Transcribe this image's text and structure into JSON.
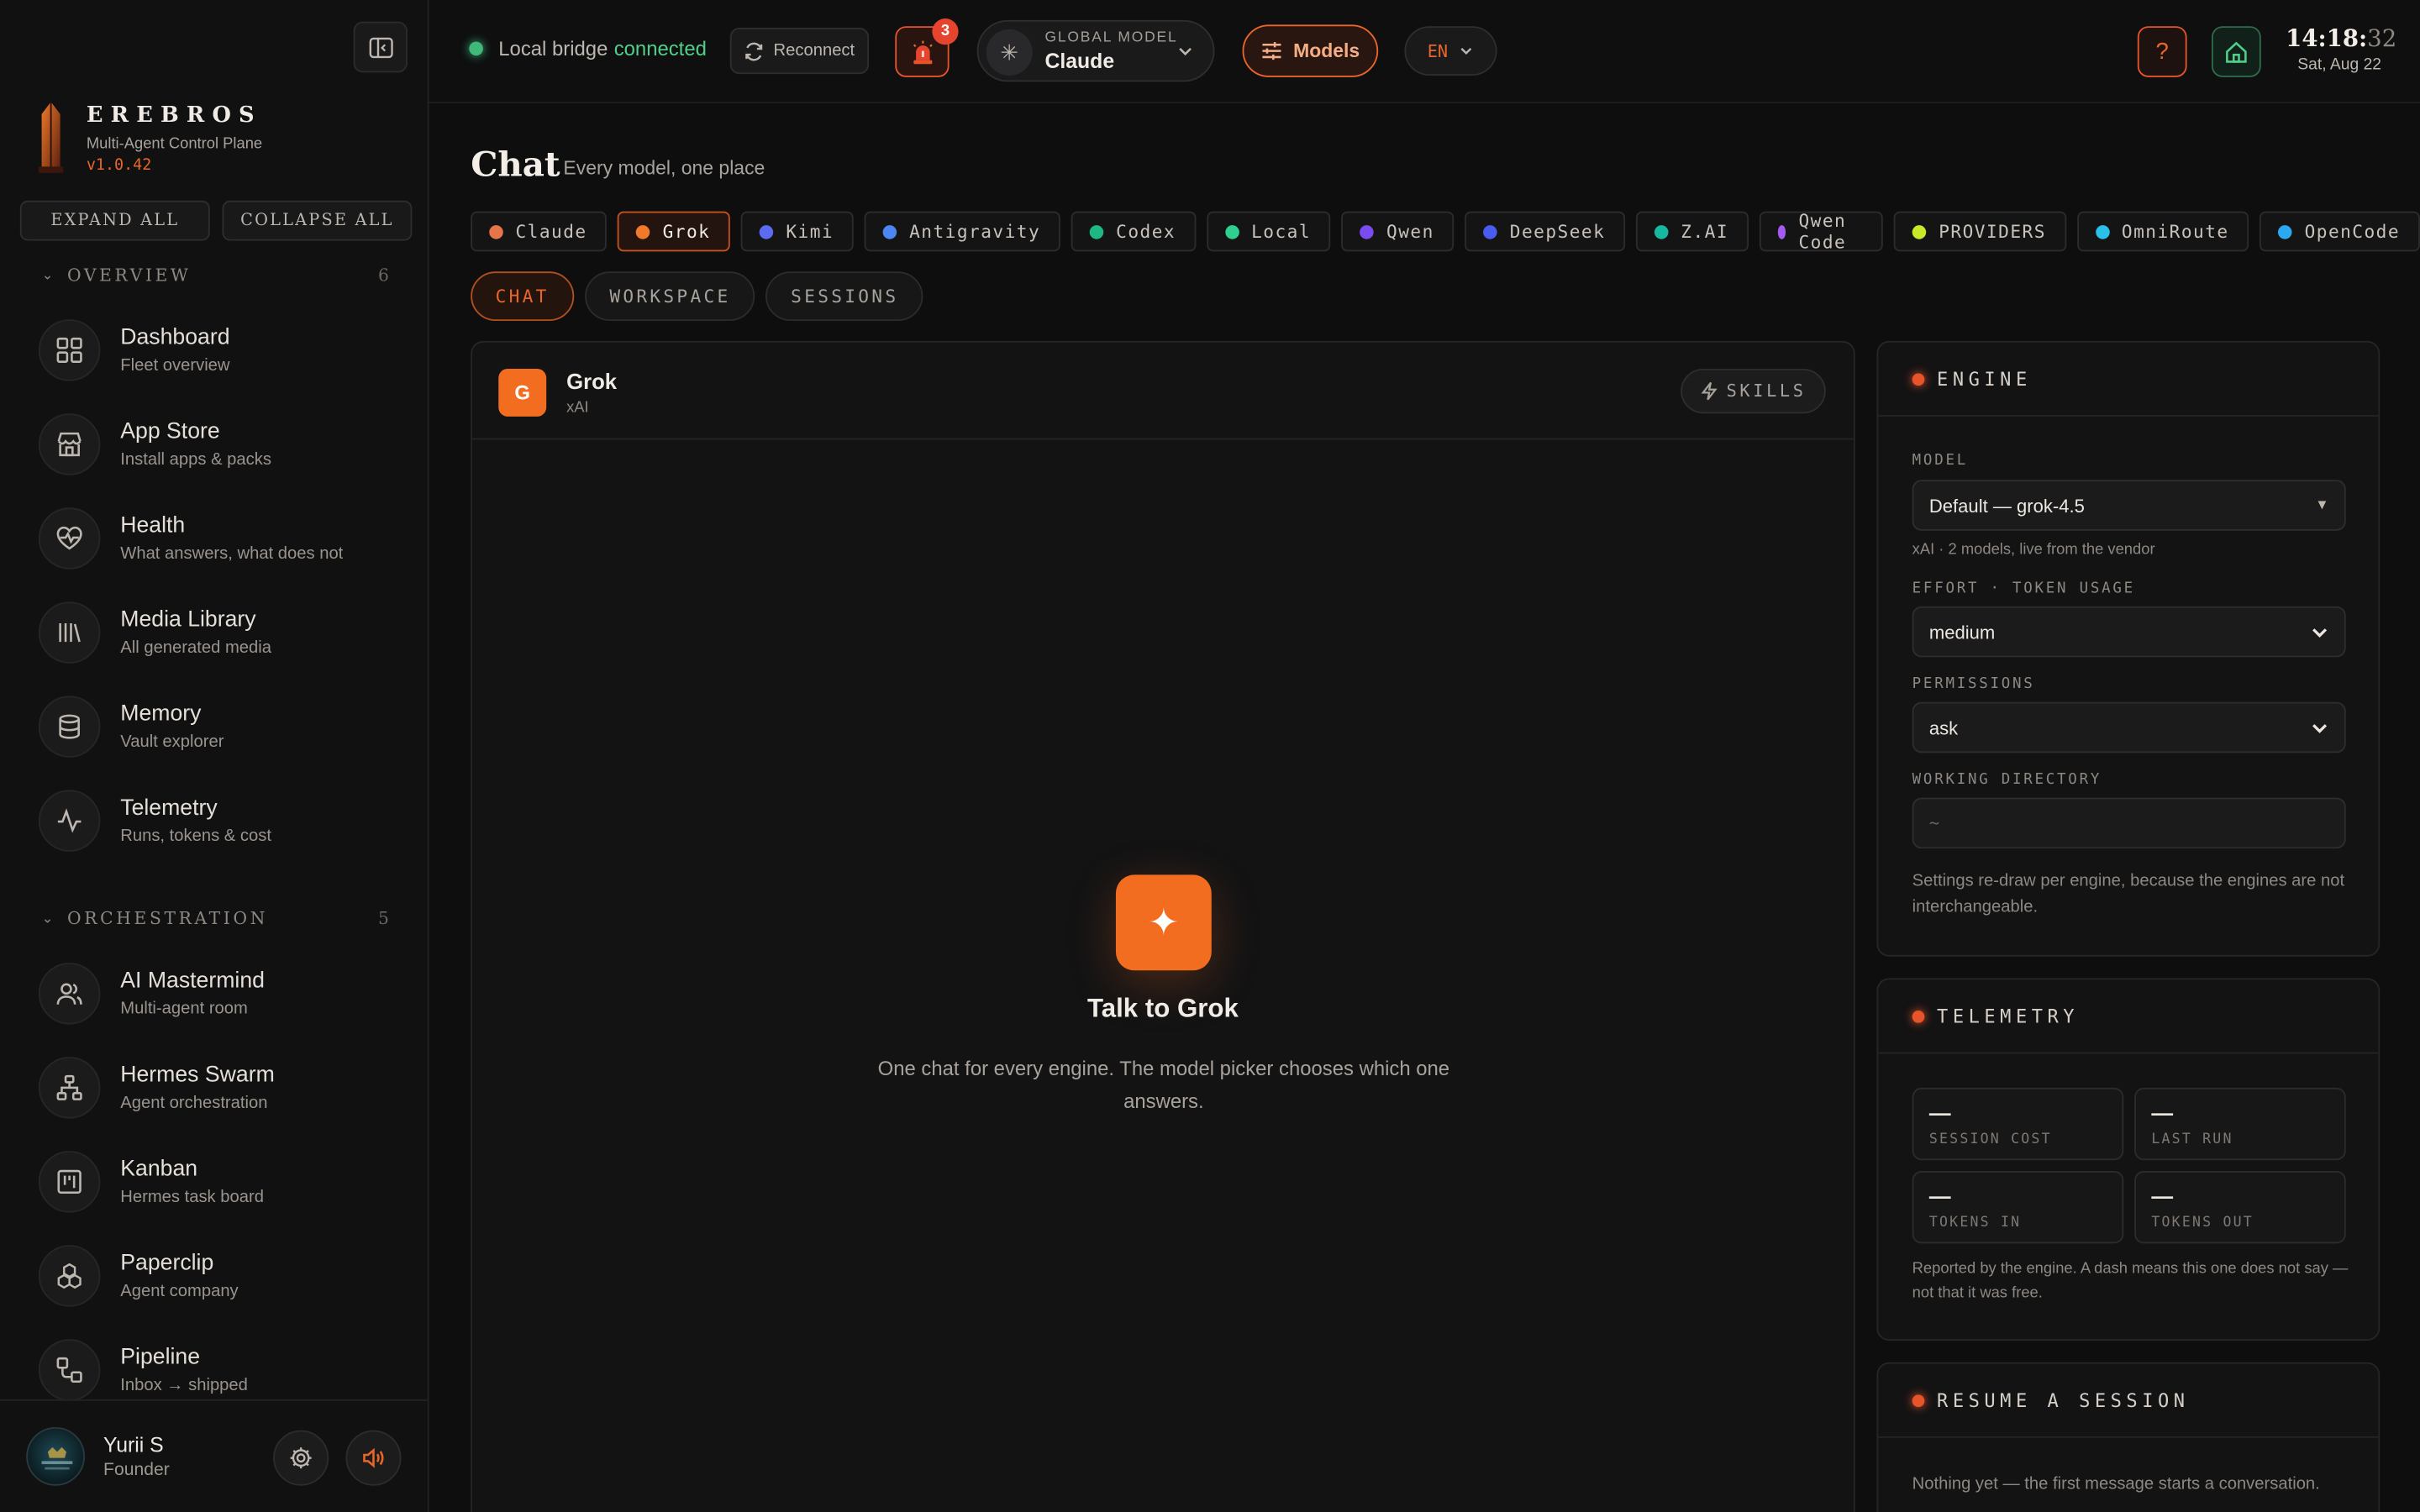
{
  "brand": {
    "title": "EREBROS",
    "subtitle": "Multi-Agent Control Plane",
    "version": "v1.0.42"
  },
  "sidebar": {
    "expand_all": "EXPAND ALL",
    "collapse_all": "COLLAPSE ALL",
    "overview": {
      "label": "OVERVIEW",
      "count": "6",
      "items": [
        {
          "title": "Dashboard",
          "sub": "Fleet overview",
          "icon": "grid-icon"
        },
        {
          "title": "App Store",
          "sub": "Install apps & packs",
          "icon": "store-icon"
        },
        {
          "title": "Health",
          "sub": "What answers, what does not",
          "icon": "heart-pulse-icon"
        },
        {
          "title": "Media Library",
          "sub": "All generated media",
          "icon": "library-icon"
        },
        {
          "title": "Memory",
          "sub": "Vault explorer",
          "icon": "database-icon"
        },
        {
          "title": "Telemetry",
          "sub": "Runs, tokens & cost",
          "icon": "activity-icon"
        }
      ]
    },
    "orchestration": {
      "label": "ORCHESTRATION",
      "count": "5",
      "items": [
        {
          "title": "AI Mastermind",
          "sub": "Multi-agent room",
          "icon": "users-icon"
        },
        {
          "title": "Hermes Swarm",
          "sub": "Agent orchestration",
          "icon": "network-icon"
        },
        {
          "title": "Kanban",
          "sub": "Hermes task board",
          "icon": "kanban-icon"
        },
        {
          "title": "Paperclip",
          "sub": "Agent company",
          "icon": "boxes-icon"
        },
        {
          "title": "Pipeline",
          "sub": "Inbox → shipped",
          "icon": "workflow-icon"
        }
      ]
    }
  },
  "user": {
    "name": "Yurii S",
    "role": "Founder"
  },
  "topbar": {
    "bridge_text": "Local bridge",
    "bridge_status": "connected",
    "reconnect": "Reconnect",
    "alarm_count": "3",
    "global_model_label": "GLOBAL MODEL",
    "global_model_value": "Claude",
    "models": "Models",
    "lang": "EN",
    "help": "?",
    "time_hm": "14:18:",
    "time_s": "32",
    "date": "Sat, Aug 22"
  },
  "page": {
    "title": "Chat",
    "subtitle": "Every model, one place"
  },
  "engines": [
    {
      "label": "Claude",
      "color": "#e8754a"
    },
    {
      "label": "Grok",
      "color": "#f07a2a",
      "active": true
    },
    {
      "label": "Kimi",
      "color": "#5b6cf0"
    },
    {
      "label": "Antigravity",
      "color": "#4c86f0"
    },
    {
      "label": "Codex",
      "color": "#1fb884"
    },
    {
      "label": "Local",
      "color": "#2fcf8f"
    },
    {
      "label": "Qwen",
      "color": "#7a4cf0"
    },
    {
      "label": "DeepSeek",
      "color": "#4a5cf0"
    },
    {
      "label": "Z.AI",
      "color": "#17b8a0"
    },
    {
      "label": "Qwen Code",
      "color": "#a45cf0"
    },
    {
      "label": "PROVIDERS",
      "color": "#c8e82a"
    },
    {
      "label": "OmniRoute",
      "color": "#2ac0e8"
    },
    {
      "label": "OpenCode",
      "color": "#2aa8f0"
    }
  ],
  "modes": [
    "CHAT",
    "WORKSPACE",
    "SESSIONS"
  ],
  "chat": {
    "name": "Grok",
    "vendor": "xAI",
    "avatar": "G",
    "skills": "SKILLS",
    "empty_title": "Talk to Grok",
    "empty_sub": "One chat for every engine. The model picker chooses which one answers."
  },
  "engine_card": {
    "title": "ENGINE",
    "model_label": "MODEL",
    "model_value": "Default — grok-4.5",
    "model_hint": "xAI · 2 models, live from the vendor",
    "effort_label": "EFFORT · TOKEN USAGE",
    "effort_value": "medium",
    "perm_label": "PERMISSIONS",
    "perm_value": "ask",
    "dir_label": "WORKING DIRECTORY",
    "dir_placeholder": "~",
    "note": "Settings re-draw per engine, because the engines are not interchangeable."
  },
  "telemetry_card": {
    "title": "TELEMETRY",
    "stats": [
      {
        "value": "—",
        "label": "SESSION COST"
      },
      {
        "value": "—",
        "label": "LAST RUN"
      },
      {
        "value": "—",
        "label": "TOKENS IN"
      },
      {
        "value": "—",
        "label": "TOKENS OUT"
      }
    ],
    "note": "Reported by the engine. A dash means this one does not say — not that it was free."
  },
  "resume_card": {
    "title": "RESUME A SESSION",
    "note": "Nothing yet — the first message starts a conversation."
  },
  "colors": {
    "accent": "#f26d1f",
    "ok": "#3fb97a",
    "danger": "#e5452e"
  }
}
